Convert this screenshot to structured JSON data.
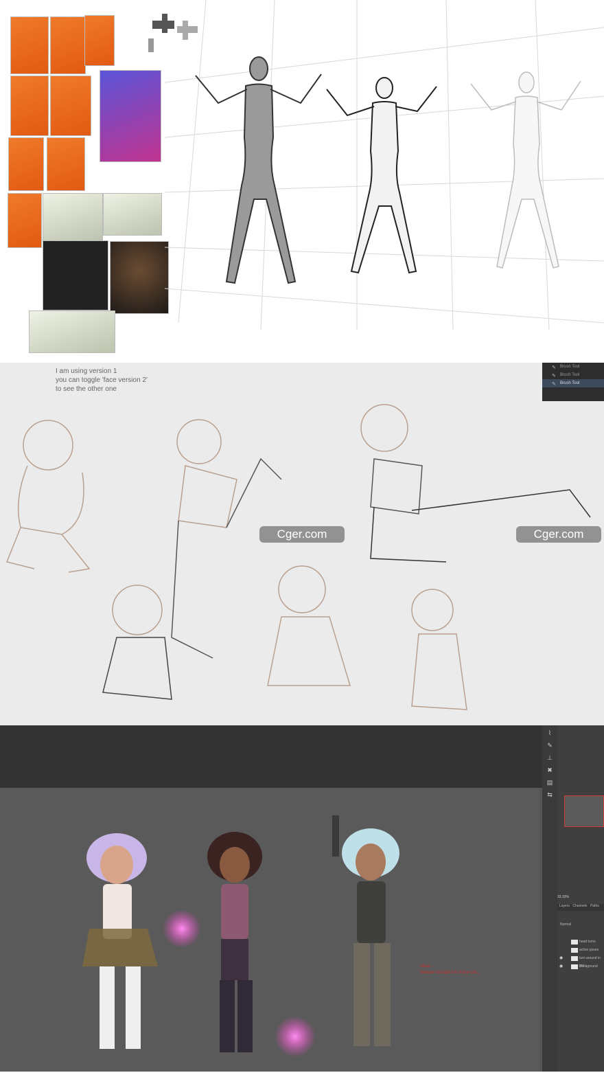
{
  "panel2": {
    "note_lines": [
      "I am using version 1",
      "you can toggle 'face version 2'",
      "to see the other one"
    ],
    "history_items": [
      "Brush Tool",
      "Brush Tool",
      "Brush Tool"
    ],
    "watermark": "Cger.com"
  },
  "panel3": {
    "zoom_level": "33.33%",
    "layer_tabs": [
      "Layers",
      "Channels",
      "Paths"
    ],
    "blend_mode": "Normal",
    "layers": [
      "head turns",
      "action poses",
      "turn around in pro...",
      "Background"
    ],
    "red_note": [
      "Ideas...",
      "Weapon brought into frame pol..."
    ]
  },
  "colors": {
    "panel1_bg": "#ffffff",
    "panel2_bg": "#ebebeb",
    "panel3_canvas": "#5a5a5a",
    "photoshop_chrome": "#333333",
    "accent_red": "#c23333",
    "magenta_glow": "#ff3fd0"
  }
}
